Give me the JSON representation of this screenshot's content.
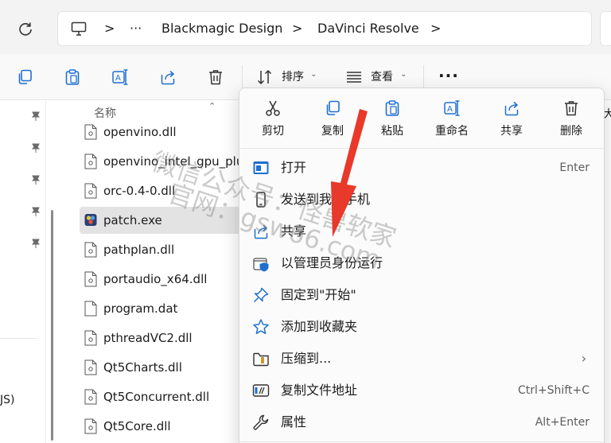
{
  "address_bar": {
    "refresh_icon": "refresh-icon",
    "computer_icon": "computer-icon",
    "ellipsis": "···",
    "crumbs": [
      "Blackmagic Design",
      "DaVinci Resolve"
    ],
    "separator": ">"
  },
  "command_bar": {
    "buttons": [
      {
        "icon": "copy-icon"
      },
      {
        "icon": "paste-icon"
      },
      {
        "icon": "rename-icon"
      },
      {
        "icon": "share-icon"
      },
      {
        "icon": "delete-icon"
      }
    ],
    "sort_label": "排序",
    "view_label": "查看",
    "more": "..."
  },
  "nav_pane": {
    "pin_count": 5,
    "partial_text": "JS)"
  },
  "file_list": {
    "column_header": "名称",
    "files": [
      {
        "name": "openvino.dll",
        "icon": "dll-file-icon",
        "selected": false
      },
      {
        "name": "openvino_intel_gpu_plu",
        "icon": "dll-file-icon",
        "selected": false
      },
      {
        "name": "orc-0.4-0.dll",
        "icon": "dll-file-icon",
        "selected": false
      },
      {
        "name": "patch.exe",
        "icon": "exe-app-icon",
        "selected": true
      },
      {
        "name": "pathplan.dll",
        "icon": "dll-file-icon",
        "selected": false
      },
      {
        "name": "portaudio_x64.dll",
        "icon": "dll-file-icon",
        "selected": false
      },
      {
        "name": "program.dat",
        "icon": "blank-file-icon",
        "selected": false
      },
      {
        "name": "pthreadVC2.dll",
        "icon": "dll-file-icon",
        "selected": false
      },
      {
        "name": "Qt5Charts.dll",
        "icon": "dll-file-icon",
        "selected": false
      },
      {
        "name": "Qt5Concurrent.dll",
        "icon": "dll-file-icon",
        "selected": false
      },
      {
        "name": "Qt5Core.dll",
        "icon": "dll-file-icon",
        "selected": false
      }
    ]
  },
  "context_menu": {
    "quick_actions": [
      {
        "label": "剪切",
        "icon": "cut-icon"
      },
      {
        "label": "复制",
        "icon": "copy-icon"
      },
      {
        "label": "粘贴",
        "icon": "paste-icon"
      },
      {
        "label": "重命名",
        "icon": "rename-icon"
      },
      {
        "label": "共享",
        "icon": "share-icon"
      },
      {
        "label": "删除",
        "icon": "delete-icon"
      }
    ],
    "items": [
      {
        "label": "打开",
        "icon": "open-app-icon",
        "shortcut": "Enter"
      },
      {
        "label": "发送到我的手机",
        "icon": "phone-icon",
        "shortcut": ""
      },
      {
        "label": "共享",
        "icon": "share-icon",
        "shortcut": ""
      },
      {
        "label": "以管理员身份运行",
        "icon": "admin-shield-icon",
        "shortcut": ""
      },
      {
        "label": "固定到\"开始\"",
        "icon": "pin-icon",
        "shortcut": ""
      },
      {
        "label": "添加到收藏夹",
        "icon": "star-icon",
        "shortcut": ""
      },
      {
        "label": "压缩到...",
        "icon": "zip-folder-icon",
        "shortcut": "",
        "submenu": "›"
      },
      {
        "label": "复制文件地址",
        "icon": "copy-path-icon",
        "shortcut": "Ctrl+Shift+C"
      },
      {
        "label": "属性",
        "icon": "wrench-icon",
        "shortcut": "Alt+Enter"
      }
    ],
    "peek_text": "大"
  },
  "watermark": {
    "line1": "微信公众号：怪兽软家",
    "line2": "官网：gsw66.com"
  },
  "colors": {
    "accent_blue": "#1e6fd1",
    "arrow_red": "#e8392a",
    "selection": "#e3e3e3"
  }
}
